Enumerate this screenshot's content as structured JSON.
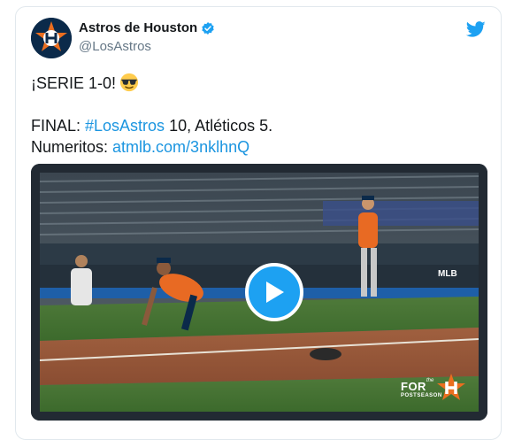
{
  "author": {
    "display_name": "Astros de Houston",
    "handle": "@LosAstros"
  },
  "tweet": {
    "line1_text": "¡SERIE 1-0!",
    "line1_emoji": "smiling-face-with-sunglasses-emoji",
    "line3_prefix": "FINAL: ",
    "line3_hashtag": "#LosAstros",
    "line3_suffix": " 10, Atléticos 5.",
    "line4_prefix": "Numeritos: ",
    "line4_link": "atmlb.com/3nklhnQ"
  },
  "media": {
    "type": "video",
    "play_icon": "play-icon",
    "watermark_for": "FOR",
    "watermark_the": "the",
    "watermark_postseason": "POSTSEASON",
    "scoreboard_text": "MLB"
  },
  "icons": {
    "verified": "verified-badge-icon",
    "platform": "twitter-bird-icon"
  },
  "colors": {
    "link": "#1b95e0",
    "twitter_blue": "#1da1f2",
    "astros_navy": "#0b2a4a",
    "astros_orange": "#eb6e1f"
  }
}
